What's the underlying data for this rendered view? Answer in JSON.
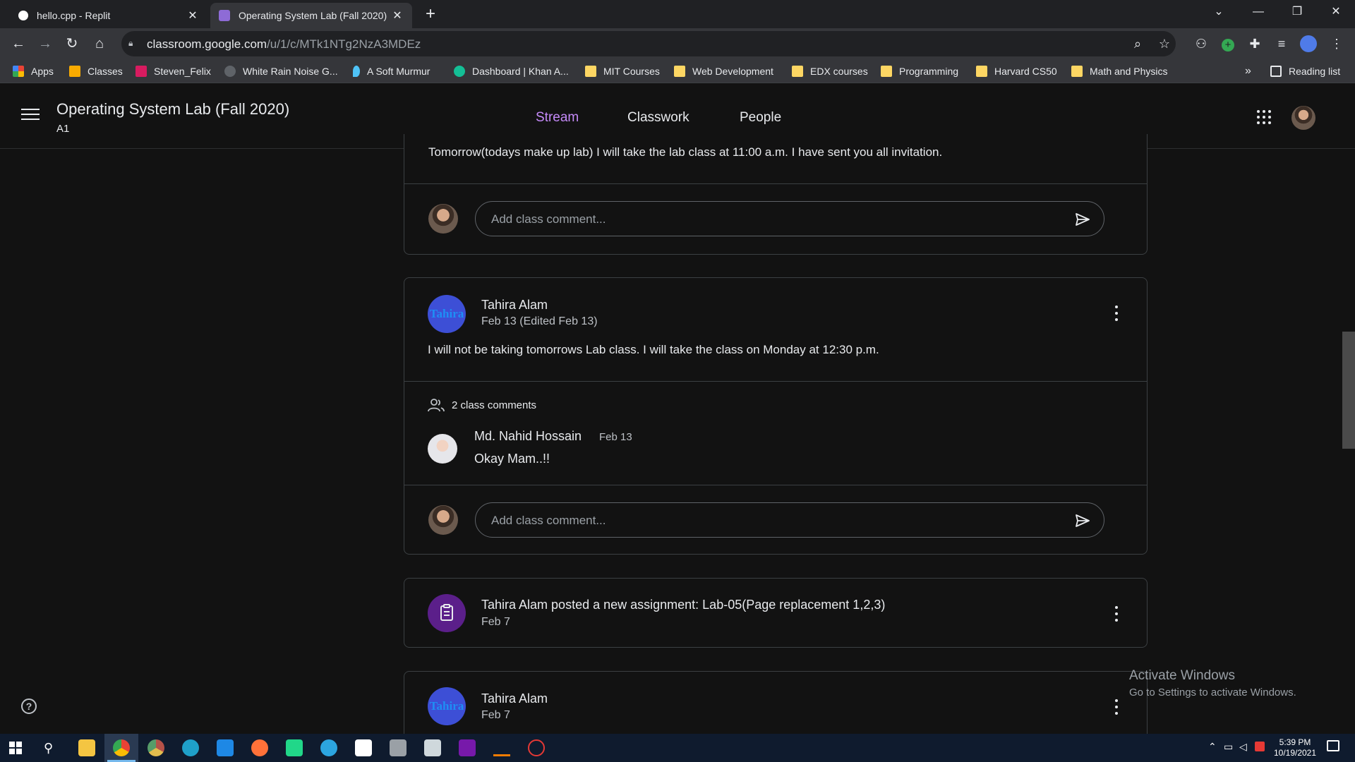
{
  "browser": {
    "tabs": [
      {
        "title": "hello.cpp - Replit",
        "active": false
      },
      {
        "title": "Operating System Lab (Fall 2020)",
        "active": true
      }
    ],
    "url_host": "classroom.google.com",
    "url_path": "/u/1/c/MTk1NTg2NzA3MDEz",
    "bookmarks": [
      "Apps",
      "Classes",
      "Steven_Felix",
      "White Rain Noise G...",
      "A Soft Murmur",
      "Dashboard | Khan A...",
      "MIT Courses",
      "Web Development",
      "EDX courses",
      "Programming",
      "Harvard CS50",
      "Math and Physics"
    ],
    "bookmarks_overflow": "»",
    "reading_list": "Reading list"
  },
  "classroom": {
    "title": "Operating System Lab (Fall 2020)",
    "section": "A1",
    "nav": [
      "Stream",
      "Classwork",
      "People"
    ],
    "comment_placeholder": "Add class comment..."
  },
  "posts": [
    {
      "body": "Tomorrow(todays make up lab) I will take the lab class at 11:00 a.m. I have sent you all invitation."
    },
    {
      "author": "Tahira Alam",
      "avatar_text": "Tahira",
      "date": "Feb 13 (Edited Feb 13)",
      "body": "I will not be taking tomorrows Lab class. I will take the class on Monday at 12:30 p.m.",
      "comments_count": "2 class comments",
      "comment": {
        "author": "Md. Nahid Hossain",
        "date": "Feb 13",
        "text": "Okay Mam..!!"
      }
    },
    {
      "title": "Tahira Alam posted a new assignment: Lab-05(Page replacement 1,2,3)",
      "date": "Feb 7"
    },
    {
      "author": "Tahira Alam",
      "avatar_text": "Tahira",
      "date": "Feb 7"
    }
  ],
  "watermark": {
    "line1": "Activate Windows",
    "line2": "Go to Settings to activate Windows."
  },
  "taskbar": {
    "time": "5:39 PM",
    "date": "10/19/2021"
  },
  "colors": {
    "accent": "#c58af9",
    "background": "#121212",
    "teacher_avatar": "#3d4fd6",
    "assignment_icon": "#5b1f8a"
  }
}
